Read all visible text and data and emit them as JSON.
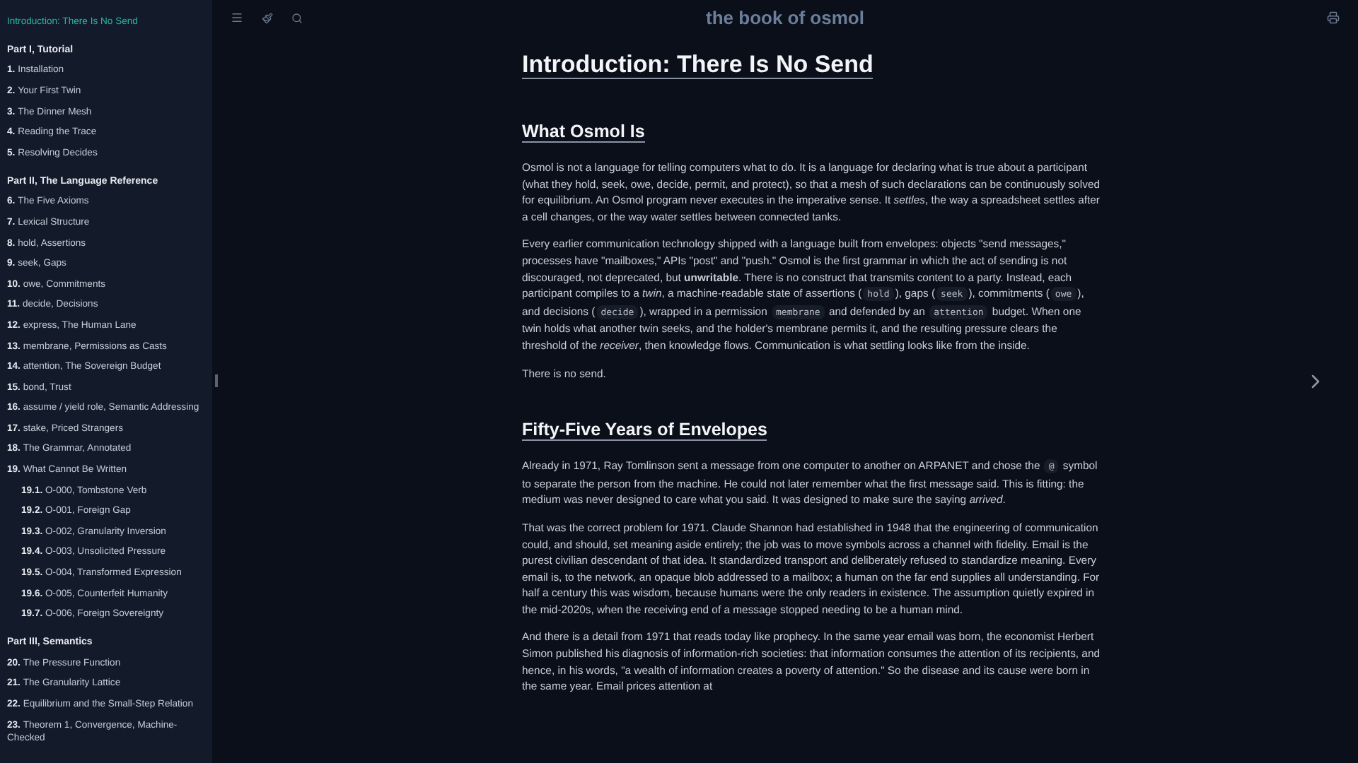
{
  "menu_bar": {
    "title": "the book of osmol"
  },
  "sidebar": {
    "items": [
      {
        "kind": "chapter",
        "title": "Introduction: There Is No Send",
        "selected": true
      },
      {
        "kind": "part",
        "title": "Part I, Tutorial"
      },
      {
        "kind": "chapter",
        "number": "1.",
        "title": "Installation",
        "selected": false
      },
      {
        "kind": "chapter",
        "number": "2.",
        "title": "Your First Twin",
        "selected": false
      },
      {
        "kind": "chapter",
        "number": "3.",
        "title": "The Dinner Mesh",
        "selected": false
      },
      {
        "kind": "chapter",
        "number": "4.",
        "title": "Reading the Trace",
        "selected": false
      },
      {
        "kind": "chapter",
        "number": "5.",
        "title": "Resolving Decides",
        "selected": false
      },
      {
        "kind": "part",
        "title": "Part II, The Language Reference"
      },
      {
        "kind": "chapter",
        "number": "6.",
        "title": "The Five Axioms",
        "selected": false
      },
      {
        "kind": "chapter",
        "number": "7.",
        "title": "Lexical Structure",
        "selected": false
      },
      {
        "kind": "chapter",
        "number": "8.",
        "title": "hold, Assertions",
        "selected": false
      },
      {
        "kind": "chapter",
        "number": "9.",
        "title": "seek, Gaps",
        "selected": false
      },
      {
        "kind": "chapter",
        "number": "10.",
        "title": "owe, Commitments",
        "selected": false
      },
      {
        "kind": "chapter",
        "number": "11.",
        "title": "decide, Decisions",
        "selected": false
      },
      {
        "kind": "chapter",
        "number": "12.",
        "title": "express, The Human Lane",
        "selected": false
      },
      {
        "kind": "chapter",
        "number": "13.",
        "title": "membrane, Permissions as Casts",
        "selected": false
      },
      {
        "kind": "chapter",
        "number": "14.",
        "title": "attention, The Sovereign Budget",
        "selected": false
      },
      {
        "kind": "chapter",
        "number": "15.",
        "title": "bond, Trust",
        "selected": false
      },
      {
        "kind": "chapter",
        "number": "16.",
        "title": "assume / yield role, Semantic Addressing",
        "selected": false
      },
      {
        "kind": "chapter",
        "number": "17.",
        "title": "stake, Priced Strangers",
        "selected": false
      },
      {
        "kind": "chapter",
        "number": "18.",
        "title": "The Grammar, Annotated",
        "selected": false
      },
      {
        "kind": "chapter",
        "number": "19.",
        "title": "What Cannot Be Written",
        "selected": false,
        "children": [
          {
            "kind": "chapter",
            "number": "19.1.",
            "title": "O-000, Tombstone Verb",
            "selected": false
          },
          {
            "kind": "chapter",
            "number": "19.2.",
            "title": "O-001, Foreign Gap",
            "selected": false
          },
          {
            "kind": "chapter",
            "number": "19.3.",
            "title": "O-002, Granularity Inversion",
            "selected": false
          },
          {
            "kind": "chapter",
            "number": "19.4.",
            "title": "O-003, Unsolicited Pressure",
            "selected": false
          },
          {
            "kind": "chapter",
            "number": "19.5.",
            "title": "O-004, Transformed Expression",
            "selected": false
          },
          {
            "kind": "chapter",
            "number": "19.6.",
            "title": "O-005, Counterfeit Humanity",
            "selected": false
          },
          {
            "kind": "chapter",
            "number": "19.7.",
            "title": "O-006, Foreign Sovereignty",
            "selected": false
          }
        ]
      },
      {
        "kind": "part",
        "title": "Part III, Semantics"
      },
      {
        "kind": "chapter",
        "number": "20.",
        "title": "The Pressure Function",
        "selected": false
      },
      {
        "kind": "chapter",
        "number": "21.",
        "title": "The Granularity Lattice",
        "selected": false
      },
      {
        "kind": "chapter",
        "number": "22.",
        "title": "Equilibrium and the Small-Step Relation",
        "selected": false
      },
      {
        "kind": "chapter",
        "number": "23.",
        "title": "Theorem 1, Convergence, Machine-Checked",
        "selected": false
      }
    ]
  },
  "content": {
    "title": "Introduction: There Is No Send",
    "blocks": [
      {
        "kind": "heading",
        "text": "What Osmol Is"
      },
      {
        "kind": "paragraph",
        "segments": [
          {
            "kind": "text",
            "text": "Osmol is not a language for telling computers what to do. It is a language for declaring what is true about a participant (what they hold, seek, owe, decide, permit, and protect), so that a mesh of such declarations can be continuously solved for equilibrium. An Osmol program never executes in the imperative sense. It *settles*, the way a spreadsheet settles after a cell changes, or the way water settles between connected tanks."
          }
        ]
      },
      {
        "kind": "paragraph",
        "segments": [
          {
            "kind": "text",
            "text": "Every earlier communication technology shipped with a language built from envelopes: objects \"send messages,\" processes have \"mailboxes,\" APIs \"post\" and \"push.\" Osmol is the first grammar in which the act of sending is not discouraged, not deprecated, but **unwritable**. There is no construct that transmits content to a party. Instead, each participant compiles to a *twin*, a machine-readable state of assertions ("
          },
          {
            "kind": "code",
            "text": "hold"
          },
          {
            "kind": "text",
            "text": "), gaps ("
          },
          {
            "kind": "code",
            "text": "seek"
          },
          {
            "kind": "text",
            "text": "), commitments ("
          },
          {
            "kind": "code",
            "text": "owe"
          },
          {
            "kind": "text",
            "text": "), and decisions ("
          },
          {
            "kind": "code",
            "text": "decide"
          },
          {
            "kind": "text",
            "text": "), wrapped in a permission "
          },
          {
            "kind": "code",
            "text": "membrane"
          },
          {
            "kind": "text",
            "text": " and defended by an "
          },
          {
            "kind": "code",
            "text": "attention"
          },
          {
            "kind": "text",
            "text": " budget. When one twin holds what another twin seeks, and the holder's membrane permits it, and the resulting pressure clears the threshold of the *receiver*, then knowledge flows. Communication is what settling looks like from the inside."
          }
        ]
      },
      {
        "kind": "paragraph",
        "segments": [
          {
            "kind": "text",
            "text": "There is no send."
          }
        ]
      },
      {
        "kind": "heading",
        "text": "Fifty-Five Years of Envelopes"
      },
      {
        "kind": "paragraph",
        "segments": [
          {
            "kind": "text",
            "text": "Already in 1971, Ray Tomlinson sent a message from one computer to another on ARPANET and chose the "
          },
          {
            "kind": "code",
            "text": "@"
          },
          {
            "kind": "text",
            "text": " symbol to separate the person from the machine. He could not later remember what the first message said. This is fitting: the medium was never designed to care what you said. It was designed to make sure the saying *arrived*."
          }
        ]
      },
      {
        "kind": "paragraph",
        "segments": [
          {
            "kind": "text",
            "text": "That was the correct problem for 1971. Claude Shannon had established in 1948 that the engineering of communication could, and should, set meaning aside entirely; the job was to move symbols across a channel with fidelity. Email is the purest civilian descendant of that idea. It standardized transport and deliberately refused to standardize meaning. Every email is, to the network, an opaque blob addressed to a mailbox; a human on the far end supplies all understanding. For half a century this was wisdom, because humans were the only readers in existence. The assumption quietly expired in the mid-2020s, when the receiving end of a message stopped needing to be a human mind."
          }
        ]
      },
      {
        "kind": "paragraph",
        "segments": [
          {
            "kind": "text",
            "text": "And there is a detail from 1971 that reads today like prophecy. In the same year email was born, the economist Herbert Simon published his diagnosis of information-rich societies: that information consumes the attention of its recipients, and hence, in his words, \"a wealth of information creates a poverty of attention.\" So the disease and its cause were born in the same year. Email prices attention at"
          }
        ]
      }
    ]
  }
}
